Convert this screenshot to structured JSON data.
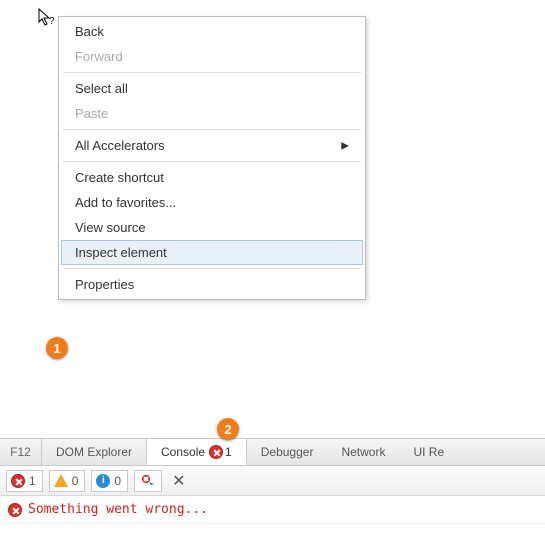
{
  "cursor": "help",
  "callouts": {
    "one": "1",
    "two": "2"
  },
  "contextMenu": {
    "items": [
      {
        "label": "Back",
        "disabled": false
      },
      {
        "label": "Forward",
        "disabled": true
      },
      {
        "sep": true
      },
      {
        "label": "Select all",
        "disabled": false
      },
      {
        "label": "Paste",
        "disabled": true
      },
      {
        "sep": true
      },
      {
        "label": "All Accelerators",
        "disabled": false,
        "submenu": true
      },
      {
        "sep": true
      },
      {
        "label": "Create shortcut",
        "disabled": false
      },
      {
        "label": "Add to favorites...",
        "disabled": false
      },
      {
        "label": "View source",
        "disabled": false
      },
      {
        "label": "Inspect element",
        "disabled": false,
        "highlighted": true
      },
      {
        "sep": true
      },
      {
        "label": "Properties",
        "disabled": false
      }
    ]
  },
  "devtools": {
    "f12": "F12",
    "tabs": [
      {
        "label": "DOM Explorer"
      },
      {
        "label": "Console",
        "active": true,
        "errorCount": "1"
      },
      {
        "label": "Debugger"
      },
      {
        "label": "Network"
      },
      {
        "label": "UI Re"
      }
    ],
    "toolbar": {
      "errors": "1",
      "warnings": "0",
      "info": "0",
      "infoGlyph": "i"
    },
    "log": {
      "message": "Something went wrong..."
    }
  }
}
